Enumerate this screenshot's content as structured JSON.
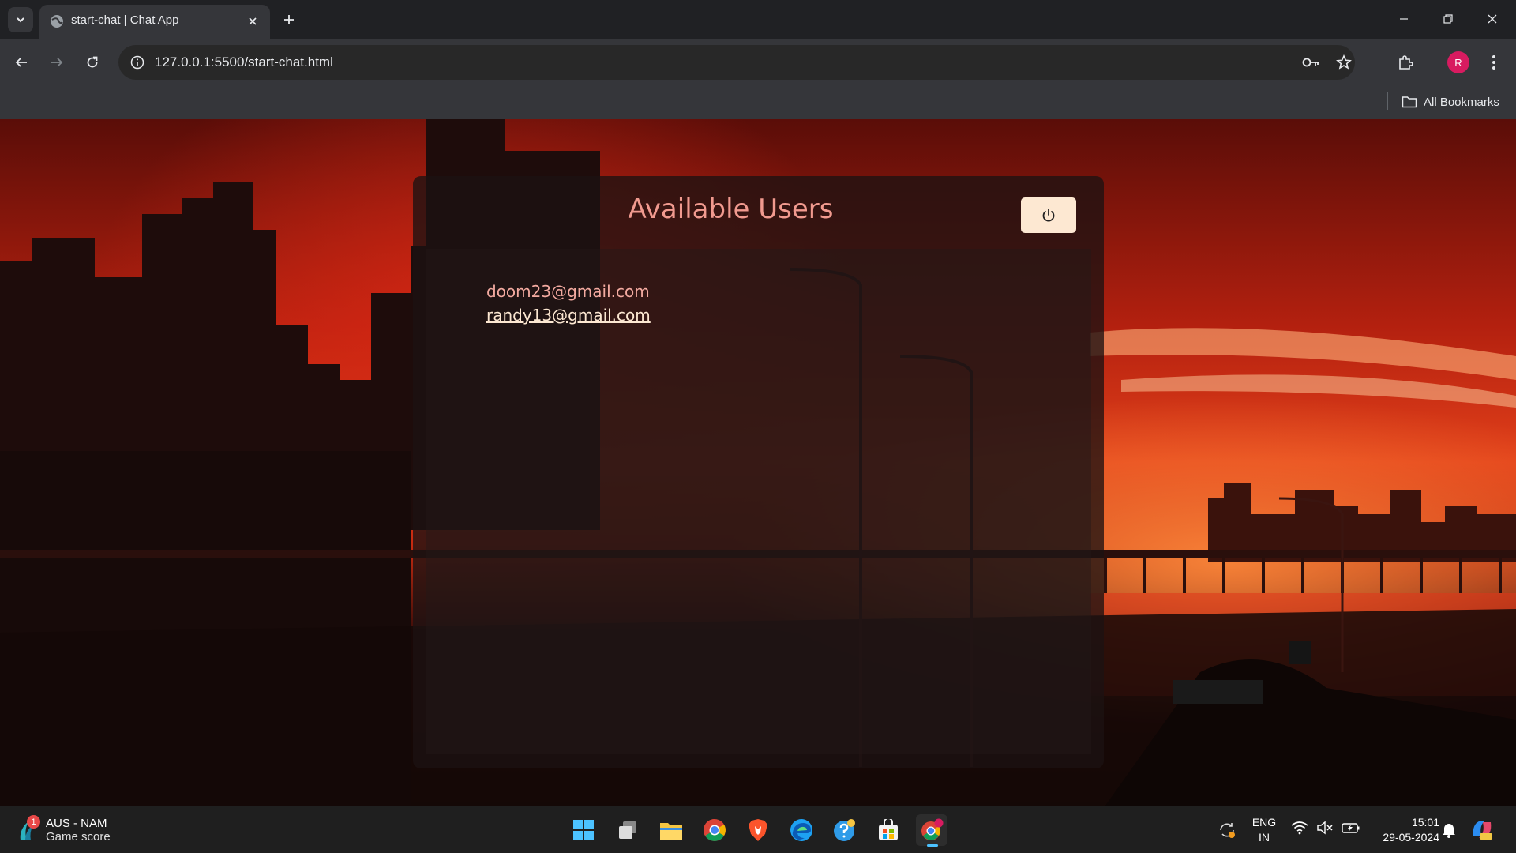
{
  "browser": {
    "tab_title": "start-chat | Chat App",
    "url": "127.0.0.1:5500/start-chat.html",
    "profile_initial": "R",
    "bookmarks_label": "All Bookmarks"
  },
  "page": {
    "title": "Available Users",
    "users": [
      "doom23@gmail.com",
      "randy13@gmail.com"
    ],
    "colors": {
      "title": "#f19a8f",
      "user": "#f3aaa0",
      "user_link": "#fde8d2",
      "button_bg": "#fde8d2"
    }
  },
  "taskbar": {
    "widget_title": "AUS - NAM",
    "widget_subtitle": "Game score",
    "widget_badge": "1",
    "lang_line1": "ENG",
    "lang_line2": "IN",
    "time": "15:01",
    "date": "29-05-2024",
    "pinned": [
      "start-icon",
      "task-view-icon",
      "file-explorer-icon",
      "chrome-icon",
      "brave-icon",
      "edge-icon",
      "help-icon",
      "store-icon",
      "chrome-profile-icon"
    ]
  }
}
